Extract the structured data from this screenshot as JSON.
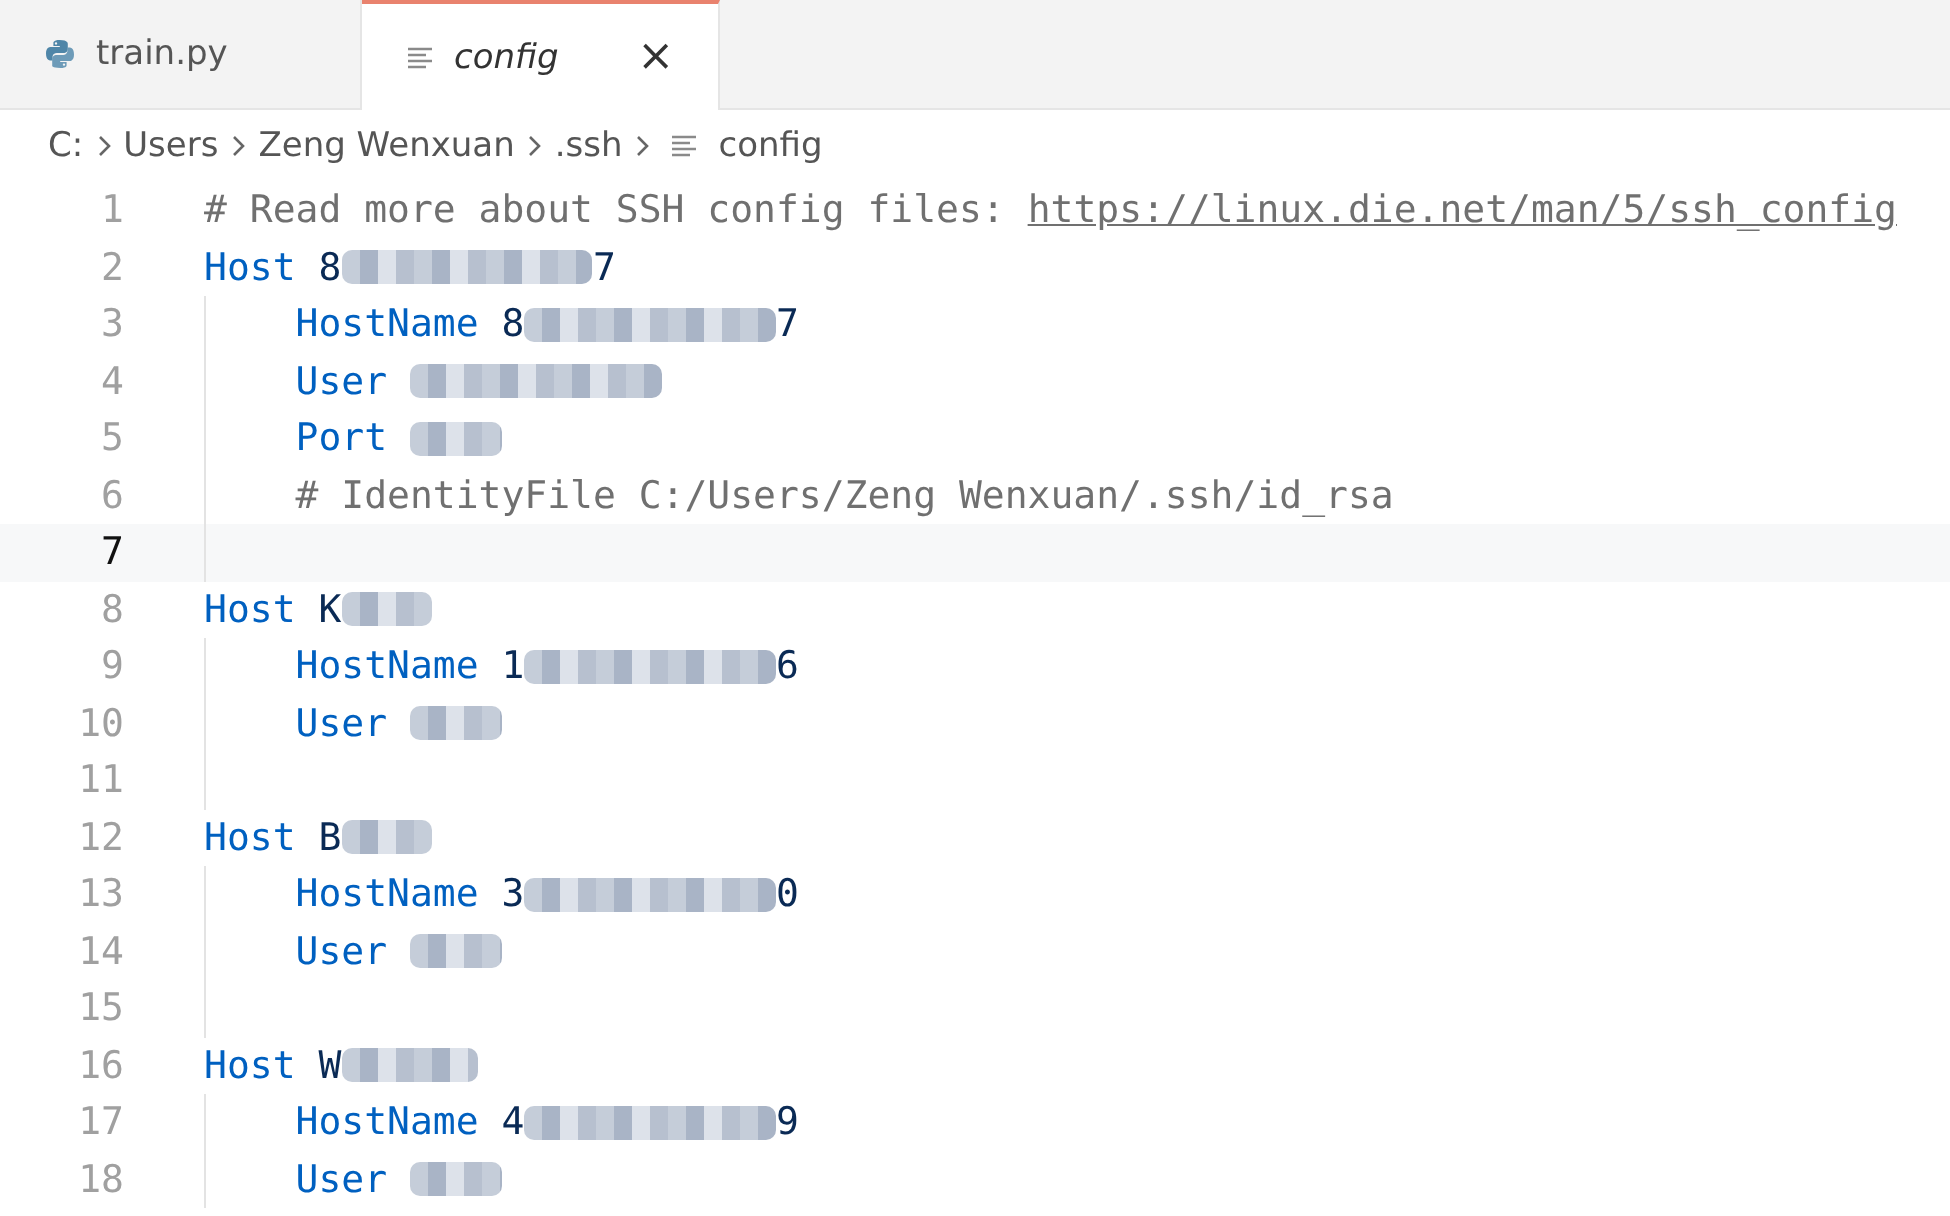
{
  "tabs": [
    {
      "label": "train.py",
      "kind": "python",
      "selected": false,
      "italic": false,
      "close": false
    },
    {
      "label": "config",
      "kind": "text",
      "selected": true,
      "italic": true,
      "close": true
    }
  ],
  "tab_close": "×",
  "breadcrumb": [
    {
      "label": "C:",
      "kind": "folder"
    },
    {
      "label": "Users",
      "kind": "folder"
    },
    {
      "label": "Zeng Wenxuan",
      "kind": "folder"
    },
    {
      "label": ".ssh",
      "kind": "folder"
    },
    {
      "label": "config",
      "kind": "file"
    }
  ],
  "lines": [
    {
      "number": "1",
      "current": false,
      "tokens": [
        {
          "kind": "comment",
          "text": "# Read more about SSH config files: "
        },
        {
          "kind": "link",
          "text": "https://linux.die.net/man/5/ssh_config"
        }
      ]
    },
    {
      "number": "2",
      "current": false,
      "tokens": [
        {
          "kind": "keyword",
          "text": "Host"
        },
        {
          "kind": "value",
          "text": "8"
        },
        {
          "kind": "redacted_long"
        },
        {
          "kind": "value",
          "text": "7"
        }
      ],
      "children": [
        {
          "number": "3",
          "current": false,
          "tokens": [
            {
              "kind": "keyword",
              "text": "HostName"
            },
            {
              "kind": "value",
              "text": "8"
            },
            {
              "kind": "redacted_long"
            },
            {
              "kind": "value",
              "text": "7"
            }
          ]
        },
        {
          "number": "4",
          "current": false,
          "tokens": [
            {
              "kind": "keyword",
              "text": "User"
            },
            {
              "kind": "redacted_long"
            }
          ]
        },
        {
          "number": "5",
          "current": false,
          "tokens": [
            {
              "kind": "keyword",
              "text": "Port"
            },
            {
              "kind": "redacted_short"
            }
          ]
        },
        {
          "number": "6",
          "current": false,
          "tokens": [
            {
              "kind": "comment",
              "text": "# IdentityFile C:/Users/Zeng Wenxuan/.ssh/id_rsa"
            }
          ]
        },
        {
          "number": "7",
          "current": true
        }
      ]
    },
    {
      "number": "8",
      "current": false,
      "tokens": [
        {
          "kind": "keyword",
          "text": "Host"
        },
        {
          "kind": "value",
          "text": "K"
        },
        {
          "kind": "redacted_short"
        }
      ],
      "children": [
        {
          "number": "9",
          "current": false,
          "tokens": [
            {
              "kind": "keyword",
              "text": "HostName"
            },
            {
              "kind": "value",
              "text": "1"
            },
            {
              "kind": "redacted_long"
            },
            {
              "kind": "value",
              "text": "6"
            }
          ]
        },
        {
          "number": "10",
          "current": false,
          "tokens": [
            {
              "kind": "keyword",
              "text": "User"
            },
            {
              "kind": "redacted_short"
            }
          ]
        },
        {
          "number": "11",
          "current": false
        }
      ]
    },
    {
      "number": "12",
      "current": false,
      "tokens": [
        {
          "kind": "keyword",
          "text": "Host"
        },
        {
          "kind": "value",
          "text": "B"
        },
        {
          "kind": "redacted_short"
        }
      ],
      "children": [
        {
          "number": "13",
          "current": false,
          "tokens": [
            {
              "kind": "keyword",
              "text": "HostName"
            },
            {
              "kind": "value",
              "text": "3"
            },
            {
              "kind": "redacted_long"
            },
            {
              "kind": "value",
              "text": "0"
            }
          ]
        },
        {
          "number": "14",
          "current": false,
          "tokens": [
            {
              "kind": "keyword",
              "text": "User"
            },
            {
              "kind": "redacted_short"
            }
          ]
        },
        {
          "number": "15",
          "current": false
        }
      ]
    },
    {
      "number": "16",
      "current": false,
      "tokens": [
        {
          "kind": "keyword",
          "text": "Host"
        },
        {
          "kind": "value",
          "text": "W"
        },
        {
          "kind": "redacted_medium"
        }
      ],
      "children": [
        {
          "number": "17",
          "current": false,
          "tokens": [
            {
              "kind": "keyword",
              "text": "HostName"
            },
            {
              "kind": "value",
              "text": "4"
            },
            {
              "kind": "redacted_long"
            },
            {
              "kind": "value",
              "text": "9"
            }
          ]
        },
        {
          "number": "18",
          "current": false,
          "tokens": [
            {
              "kind": "keyword",
              "text": "User"
            },
            {
              "kind": "redacted_short"
            }
          ]
        }
      ]
    }
  ]
}
